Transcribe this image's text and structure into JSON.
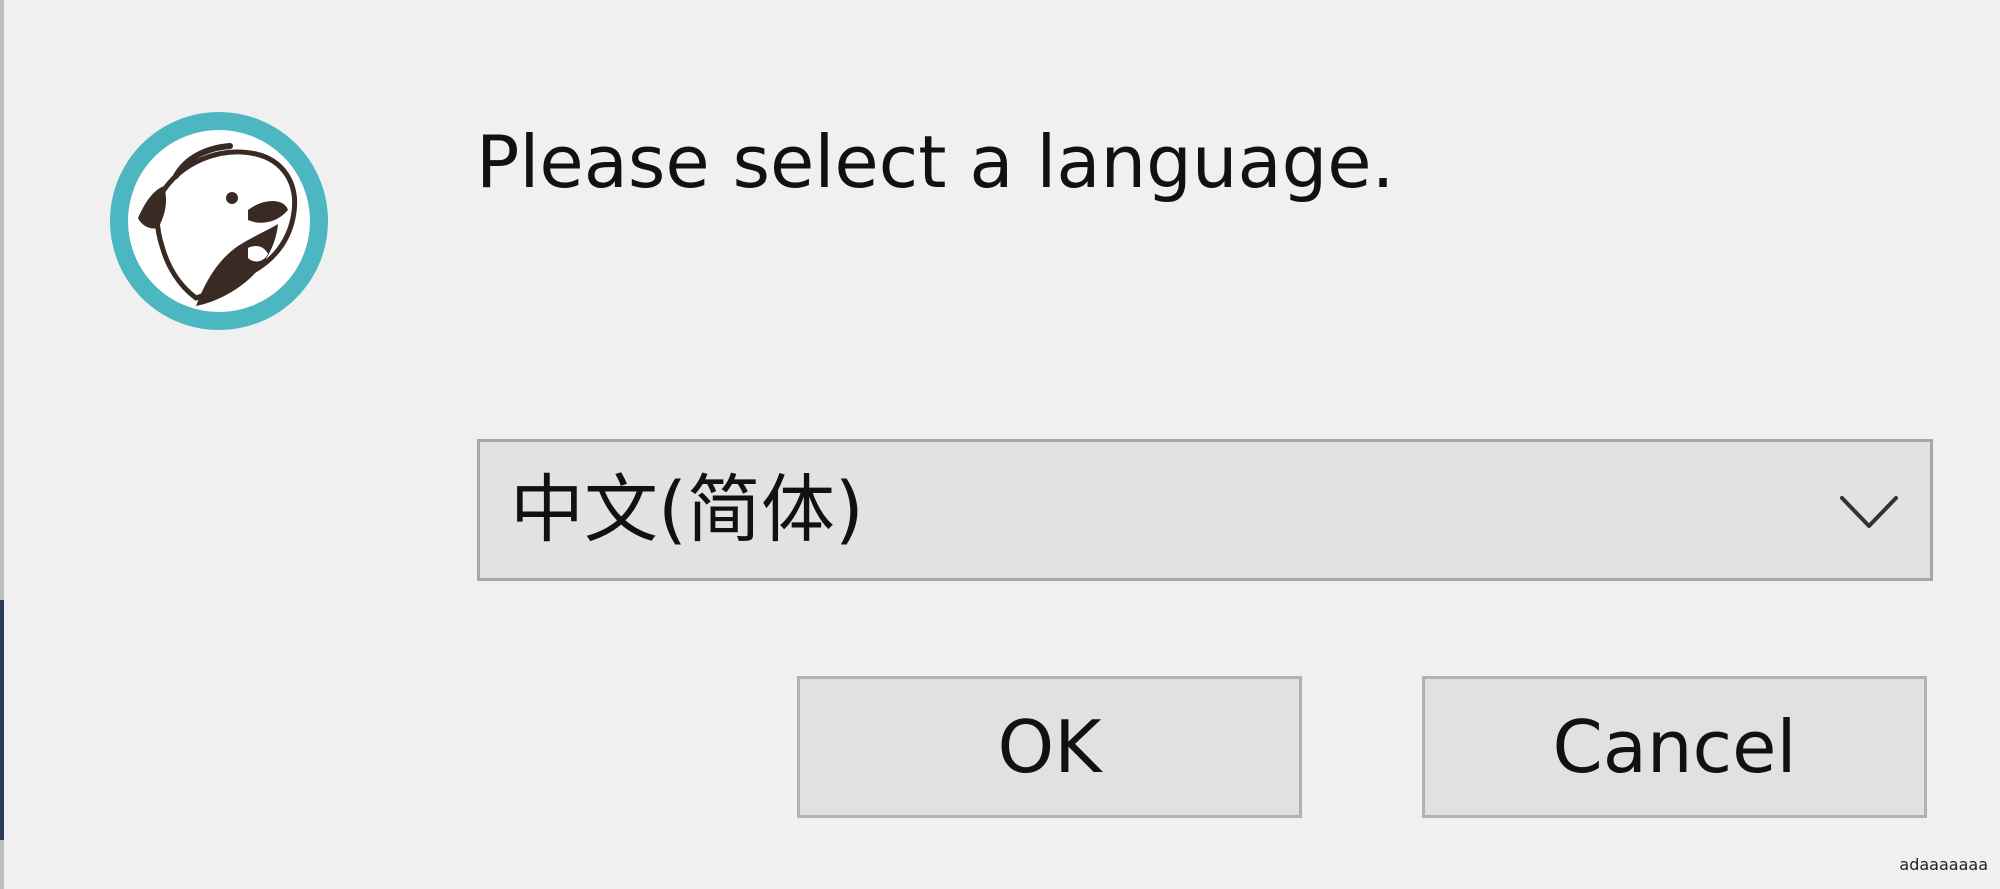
{
  "dialog": {
    "prompt": "Please select a language.",
    "logo_icon": "beaver-logo-icon",
    "colors": {
      "background": "#f0f0f0",
      "logo_ring": "#4cb6c1",
      "logo_ink": "#3a2a24",
      "button_face": "#e1e1e1",
      "border": "#a7a7a7"
    }
  },
  "language_select": {
    "selected": "中文(简体)",
    "chevron_icon": "chevron-down-icon"
  },
  "buttons": {
    "ok_label": "OK",
    "cancel_label": "Cancel"
  },
  "watermark": {
    "text": "adaaaaaaa"
  }
}
